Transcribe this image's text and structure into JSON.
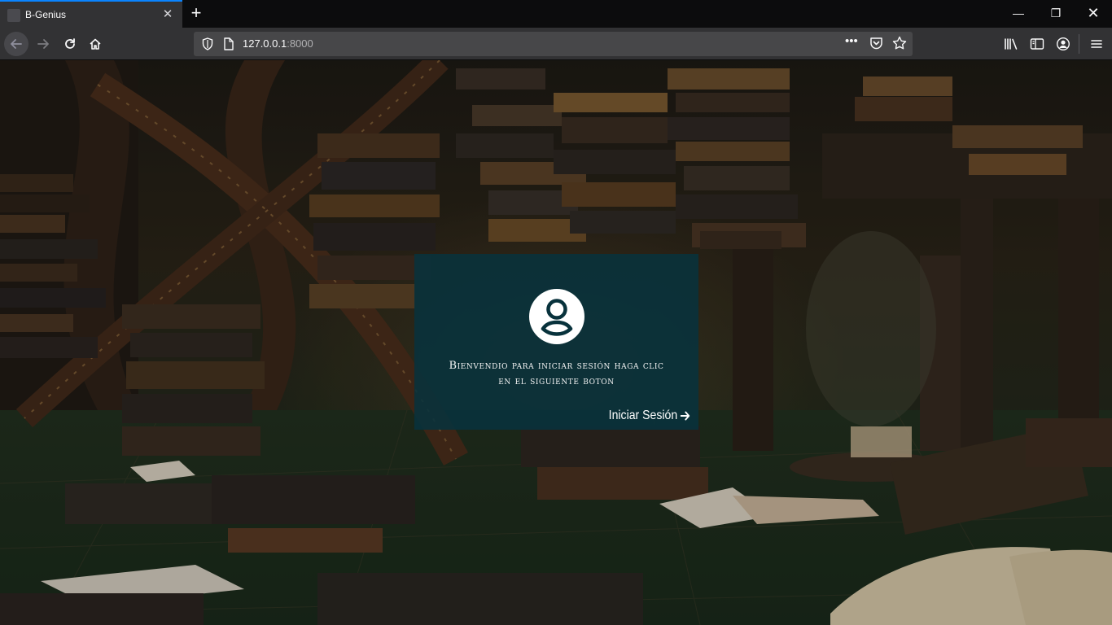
{
  "browser": {
    "tab_title": "B-Genius",
    "tab_close_glyph": "✕",
    "new_tab_glyph": "+",
    "url_host": "127.0.0.1",
    "url_port": ":8000",
    "url_more_glyph": "•••",
    "window_controls": {
      "minimize": "—",
      "maximize": "❐",
      "close": "✕"
    },
    "icons": [
      "back-arrow-icon",
      "forward-arrow-icon",
      "reload-icon",
      "home-icon",
      "shield-icon",
      "page-icon",
      "pocket-icon",
      "bookmark-star-icon",
      "library-icon",
      "sidebar-icon",
      "account-icon",
      "hamburger-menu-icon"
    ]
  },
  "page": {
    "welcome_line1": "Bienvendio para iniciar sesión haga clic",
    "welcome_line2": "en el siguiente boton",
    "login_label": "Iniciar Sesión",
    "login_icon": "arrow-right-icon",
    "avatar_icon": "user-circle-icon",
    "card_color": "#08323c",
    "accent": "#0a84ff"
  }
}
